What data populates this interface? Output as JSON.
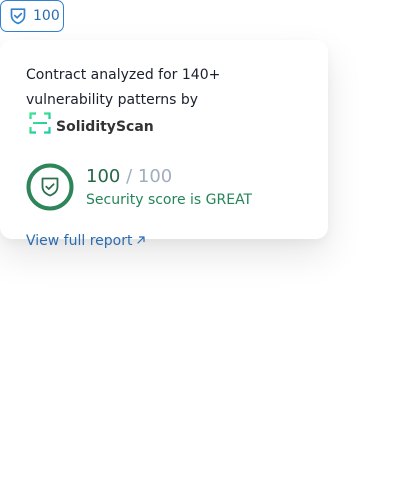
{
  "badge": {
    "icon": "shield-check-icon",
    "score": "100"
  },
  "popover": {
    "intro_text": "Contract analyzed for 140+ vulnerability patterns by",
    "brand": {
      "icon": "solidityscan-logo-icon",
      "name": "SolidityScan"
    },
    "score": {
      "value": "100",
      "max": "/ 100",
      "fraction": 1.0,
      "status": "Security score is GREAT",
      "icon": "shield-check-icon"
    },
    "link": {
      "label": "View full report",
      "icon": "external-arrow-icon"
    }
  },
  "colors": {
    "badge_blue": "#3182ce",
    "great_green": "#2f855a",
    "brand_green": "#1fd67e",
    "link_blue": "#2b6cb0"
  }
}
